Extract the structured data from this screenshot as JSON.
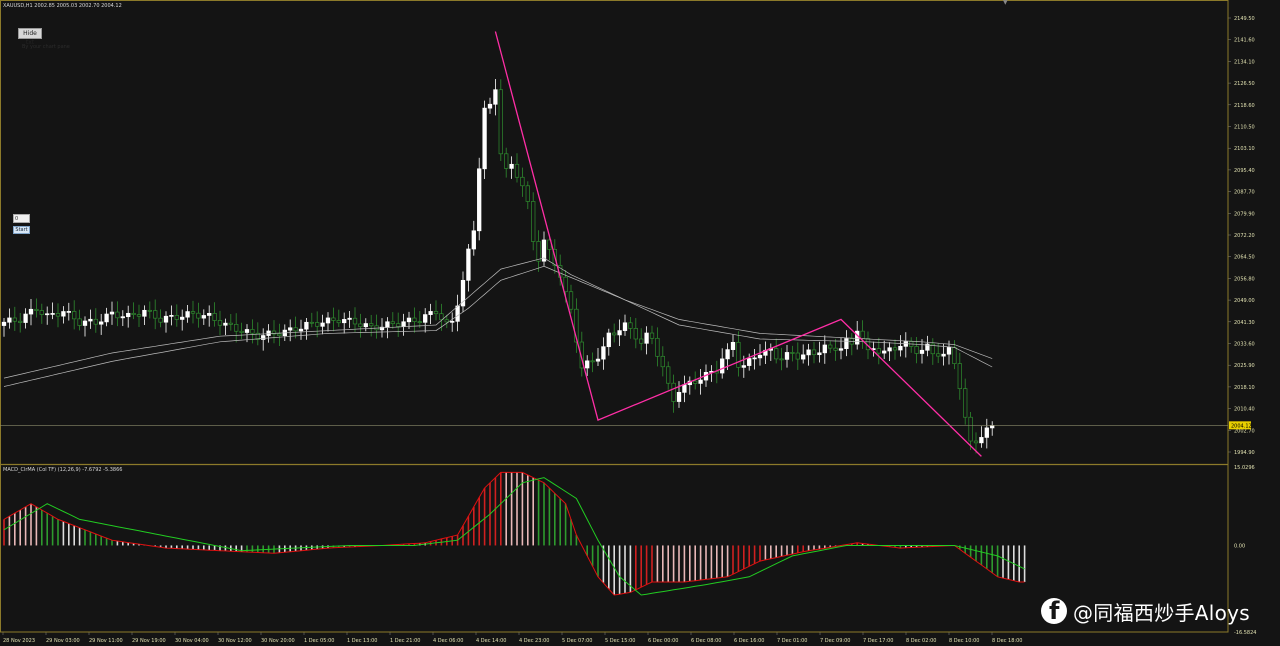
{
  "symbol_info": "XAUUSD,H1  2002.85 2005.03 2002.70 2004.12",
  "hide_button_label": "Hide txt",
  "note_text": "By your chart pane",
  "input_value": "0",
  "start_button_label": "Start",
  "macd_label": "MACD_ClrMA (Col TF) (12,26,9) -7.6792 -5.3866",
  "current_price": "2004.12",
  "price_axis": [
    "2149.50",
    "2141.60",
    "2134.10",
    "2126.50",
    "2118.60",
    "2110.50",
    "2103.10",
    "2095.40",
    "2087.70",
    "2079.90",
    "2072.20",
    "2064.50",
    "2056.80",
    "2049.00",
    "2041.30",
    "2033.60",
    "2025.90",
    "2018.10",
    "2010.40",
    "2002.70",
    "1994.90"
  ],
  "macd_axis": [
    "15.0296",
    "0.00",
    "-16.5824"
  ],
  "time_axis": [
    "28 Nov 2023",
    "29 Nov 03:00",
    "29 Nov 11:00",
    "29 Nov 19:00",
    "30 Nov 04:00",
    "30 Nov 12:00",
    "30 Nov 20:00",
    "1 Dec 05:00",
    "1 Dec 13:00",
    "1 Dec 21:00",
    "4 Dec 06:00",
    "4 Dec 14:00",
    "4 Dec 23:00",
    "5 Dec 07:00",
    "5 Dec 15:00",
    "6 Dec 00:00",
    "6 Dec 08:00",
    "6 Dec 16:00",
    "7 Dec 01:00",
    "7 Dec 09:00",
    "7 Dec 17:00",
    "8 Dec 02:00",
    "8 Dec 10:00",
    "8 Dec 18:00"
  ],
  "watermark": "@同福西炒手Aloys",
  "colors": {
    "background": "#141414",
    "bull": "#ffffff",
    "bear": "#2e8b2e",
    "zigzag": "#ff2ea6",
    "macd_line": "#e01010",
    "signal_line": "#22cc22",
    "hist_up_strong": "#d02020",
    "hist_up_weak": "#e8b8b8",
    "hist_down_strong": "#2e9b2e",
    "hist_down_weak": "#dddddd",
    "axis_text": "#e0e0b0",
    "price_tag": "#e8d000",
    "ma_line": "#bbbbbb",
    "separator": "#8c7a2a"
  },
  "chart_data": [
    {
      "type": "candlestick",
      "title": "XAUUSD,H1",
      "ylim": [
        1991.0,
        2153.4
      ],
      "x_labels": [
        "28 Nov 2023",
        "29 Nov 03:00",
        "29 Nov 11:00",
        "29 Nov 19:00",
        "30 Nov 04:00",
        "30 Nov 12:00",
        "30 Nov 20:00",
        "1 Dec 05:00",
        "1 Dec 13:00",
        "1 Dec 21:00",
        "4 Dec 06:00",
        "4 Dec 14:00",
        "4 Dec 23:00",
        "5 Dec 07:00",
        "5 Dec 15:00",
        "6 Dec 00:00",
        "6 Dec 08:00",
        "6 Dec 16:00",
        "7 Dec 01:00",
        "7 Dec 09:00",
        "7 Dec 17:00",
        "8 Dec 02:00",
        "8 Dec 10:00",
        "8 Dec 18:00"
      ],
      "anchors": [
        [
          0,
          2041
        ],
        [
          3,
          2042
        ],
        [
          6,
          2046
        ],
        [
          8,
          2043
        ],
        [
          11,
          2045
        ],
        [
          14,
          2041
        ],
        [
          17,
          2041
        ],
        [
          20,
          2044
        ],
        [
          23,
          2043
        ],
        [
          26,
          2045
        ],
        [
          29,
          2042
        ],
        [
          32,
          2043
        ],
        [
          35,
          2044
        ],
        [
          38,
          2043
        ],
        [
          41,
          2040
        ],
        [
          44,
          2038
        ],
        [
          47,
          2036
        ],
        [
          50,
          2037
        ],
        [
          53,
          2038
        ],
        [
          56,
          2040
        ],
        [
          59,
          2041
        ],
        [
          62,
          2042
        ],
        [
          65,
          2041
        ],
        [
          68,
          2039
        ],
        [
          71,
          2040
        ],
        [
          74,
          2041
        ],
        [
          77,
          2042
        ],
        [
          80,
          2045
        ],
        [
          82,
          2040
        ],
        [
          83,
          2041
        ],
        [
          84,
          2048
        ],
        [
          85,
          2056
        ],
        [
          86,
          2066
        ],
        [
          87,
          2074
        ],
        [
          88,
          2097
        ],
        [
          89,
          2117
        ],
        [
          90,
          2118
        ],
        [
          91,
          2125
        ],
        [
          92,
          2102
        ],
        [
          93,
          2095
        ],
        [
          94,
          2097
        ],
        [
          95,
          2094
        ],
        [
          96,
          2090
        ],
        [
          97,
          2083
        ],
        [
          98,
          2070
        ],
        [
          99,
          2064
        ],
        [
          100,
          2070
        ],
        [
          101,
          2066
        ],
        [
          102,
          2062
        ],
        [
          103,
          2058
        ],
        [
          104,
          2051
        ],
        [
          105,
          2045
        ],
        [
          106,
          2035
        ],
        [
          107,
          2025
        ],
        [
          108,
          2026
        ],
        [
          109,
          2027
        ],
        [
          110,
          2029
        ],
        [
          111,
          2032
        ],
        [
          112,
          2036
        ],
        [
          113,
          2037
        ],
        [
          114,
          2039
        ],
        [
          115,
          2040
        ],
        [
          116,
          2038
        ],
        [
          117,
          2036
        ],
        [
          118,
          2034
        ],
        [
          119,
          2036
        ],
        [
          120,
          2035
        ],
        [
          121,
          2030
        ],
        [
          122,
          2025
        ],
        [
          123,
          2018
        ],
        [
          124,
          2013
        ],
        [
          125,
          2017
        ],
        [
          126,
          2018
        ],
        [
          127,
          2019
        ],
        [
          128,
          2020
        ],
        [
          129,
          2021
        ],
        [
          130,
          2022
        ],
        [
          131,
          2023
        ],
        [
          132,
          2024
        ],
        [
          133,
          2028
        ],
        [
          134,
          2030
        ],
        [
          135,
          2034
        ],
        [
          136,
          2026
        ],
        [
          137,
          2025
        ],
        [
          138,
          2027
        ],
        [
          139,
          2029
        ],
        [
          140,
          2030
        ],
        [
          141,
          2030
        ],
        [
          142,
          2031
        ],
        [
          143,
          2029
        ],
        [
          144,
          2028
        ],
        [
          145,
          2029
        ],
        [
          146,
          2030
        ],
        [
          147,
          2029
        ],
        [
          148,
          2029
        ],
        [
          149,
          2030
        ],
        [
          150,
          2030
        ],
        [
          151,
          2031
        ],
        [
          152,
          2032
        ],
        [
          153,
          2031
        ],
        [
          154,
          2032
        ],
        [
          155,
          2032
        ],
        [
          156,
          2034
        ],
        [
          157,
          2033
        ],
        [
          158,
          2039
        ],
        [
          159,
          2035
        ],
        [
          160,
          2030
        ],
        [
          161,
          2032
        ],
        [
          162,
          2031
        ],
        [
          163,
          2030
        ],
        [
          164,
          2031
        ],
        [
          165,
          2032
        ],
        [
          166,
          2033
        ],
        [
          167,
          2033
        ],
        [
          168,
          2032
        ],
        [
          169,
          2031
        ],
        [
          170,
          2031
        ],
        [
          171,
          2032
        ],
        [
          172,
          2030
        ],
        [
          173,
          2030
        ],
        [
          174,
          2029
        ],
        [
          175,
          2031
        ],
        [
          176,
          2027
        ],
        [
          177,
          2018
        ],
        [
          178,
          2006
        ],
        [
          179,
          1998
        ],
        [
          180,
          1999
        ],
        [
          181,
          2000
        ],
        [
          182,
          2002
        ],
        [
          183,
          2004
        ]
      ],
      "zigzag": [
        [
          91,
          2145
        ],
        [
          110,
          2006
        ],
        [
          155,
          2042
        ],
        [
          181,
          1993
        ]
      ],
      "ma_fast": [
        [
          0,
          2021
        ],
        [
          20,
          2030
        ],
        [
          40,
          2036
        ],
        [
          60,
          2038
        ],
        [
          80,
          2040
        ],
        [
          86,
          2050
        ],
        [
          92,
          2060
        ],
        [
          100,
          2064
        ],
        [
          105,
          2058
        ],
        [
          115,
          2049
        ],
        [
          125,
          2040
        ],
        [
          140,
          2035
        ],
        [
          160,
          2034
        ],
        [
          170,
          2033
        ],
        [
          176,
          2032
        ],
        [
          183,
          2025
        ]
      ],
      "ma_slow": [
        [
          0,
          2018
        ],
        [
          20,
          2027
        ],
        [
          40,
          2034
        ],
        [
          60,
          2037
        ],
        [
          80,
          2038
        ],
        [
          86,
          2046
        ],
        [
          92,
          2056
        ],
        [
          100,
          2061
        ],
        [
          105,
          2057
        ],
        [
          115,
          2049
        ],
        [
          125,
          2042
        ],
        [
          140,
          2037
        ],
        [
          160,
          2035
        ],
        [
          170,
          2034
        ],
        [
          176,
          2033
        ],
        [
          183,
          2028
        ]
      ]
    },
    {
      "type": "macd",
      "title": "MACD_ClrMA (Col TF) (12,26,9)",
      "ylim": [
        -16.58,
        15.03
      ],
      "macd": [
        [
          0,
          5
        ],
        [
          5,
          8
        ],
        [
          10,
          5
        ],
        [
          20,
          1
        ],
        [
          30,
          -0.5
        ],
        [
          40,
          -1
        ],
        [
          50,
          -1.5
        ],
        [
          60,
          -0.5
        ],
        [
          70,
          0
        ],
        [
          78,
          0.5
        ],
        [
          84,
          2
        ],
        [
          89,
          11
        ],
        [
          92,
          14
        ],
        [
          96,
          14
        ],
        [
          100,
          12
        ],
        [
          104,
          8
        ],
        [
          106,
          2
        ],
        [
          110,
          -6
        ],
        [
          113,
          -9.5
        ],
        [
          116,
          -9
        ],
        [
          120,
          -7
        ],
        [
          126,
          -7
        ],
        [
          134,
          -6
        ],
        [
          140,
          -3
        ],
        [
          148,
          -1.2
        ],
        [
          158,
          0.5
        ],
        [
          166,
          -0.5
        ],
        [
          176,
          0
        ],
        [
          184,
          -6
        ],
        [
          188,
          -7
        ],
        [
          190,
          -7
        ]
      ],
      "signal": [
        [
          0,
          3
        ],
        [
          8,
          8
        ],
        [
          14,
          5
        ],
        [
          24,
          3
        ],
        [
          34,
          1
        ],
        [
          44,
          -1
        ],
        [
          54,
          -0.5
        ],
        [
          64,
          0
        ],
        [
          76,
          0
        ],
        [
          84,
          1
        ],
        [
          90,
          6
        ],
        [
          96,
          12
        ],
        [
          100,
          13
        ],
        [
          106,
          9
        ],
        [
          110,
          1
        ],
        [
          114,
          -6
        ],
        [
          118,
          -9.5
        ],
        [
          124,
          -8.5
        ],
        [
          130,
          -7.5
        ],
        [
          138,
          -6
        ],
        [
          146,
          -2
        ],
        [
          156,
          0
        ],
        [
          166,
          0
        ],
        [
          176,
          0
        ],
        [
          184,
          -2
        ],
        [
          190,
          -5
        ]
      ]
    }
  ]
}
